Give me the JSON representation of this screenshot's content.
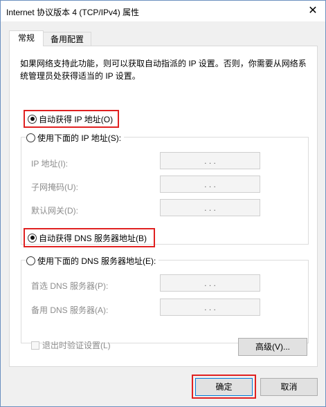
{
  "window": {
    "title": "Internet 协议版本 4 (TCP/IPv4) 属性",
    "close_symbol": "✕"
  },
  "tabs": [
    {
      "label": "常规"
    },
    {
      "label": "备用配置"
    }
  ],
  "description": "如果网络支持此功能，则可以获取自动指派的 IP 设置。否则，你需要从网络系统管理员处获得适当的 IP 设置。",
  "ip_section": {
    "auto_label": "自动获得 IP 地址(O)",
    "manual_label": "使用下面的 IP 地址(S):",
    "auto_selected": true,
    "fields": [
      {
        "label": "IP 地址(I):",
        "value": ". . ."
      },
      {
        "label": "子网掩码(U):",
        "value": ". . ."
      },
      {
        "label": "默认网关(D):",
        "value": ". . ."
      }
    ]
  },
  "dns_section": {
    "auto_label": "自动获得 DNS 服务器地址(B)",
    "manual_label": "使用下面的 DNS 服务器地址(E):",
    "auto_selected": true,
    "fields": [
      {
        "label": "首选 DNS 服务器(P):",
        "value": ". . ."
      },
      {
        "label": "备用 DNS 服务器(A):",
        "value": ". . ."
      }
    ]
  },
  "validate_on_exit": {
    "label": "退出时验证设置(L)",
    "checked": false,
    "enabled": false
  },
  "buttons": {
    "advanced": "高级(V)...",
    "ok": "确定",
    "cancel": "取消"
  },
  "colors": {
    "highlight": "#e02020",
    "window_border": "#6b8fbf"
  }
}
